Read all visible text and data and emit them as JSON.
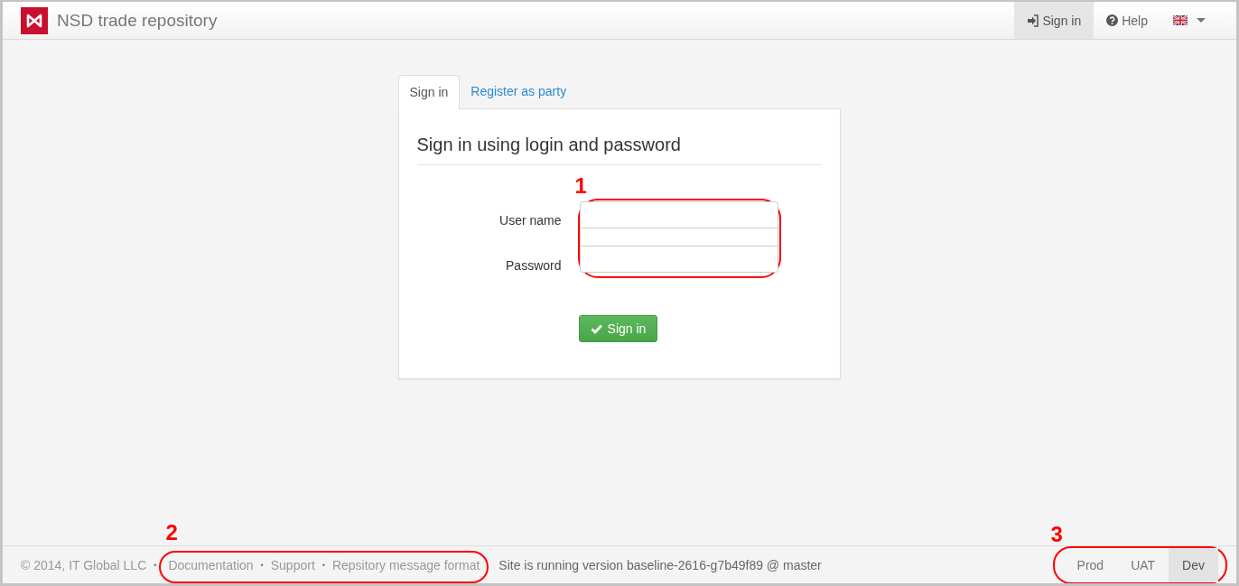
{
  "navbar": {
    "brand": "NSD trade repository",
    "items": [
      {
        "kind": "signin",
        "label": "Sign in",
        "selected": true
      },
      {
        "kind": "help",
        "label": "Help",
        "selected": false
      },
      {
        "kind": "language",
        "selected": false
      }
    ]
  },
  "tabs": [
    {
      "label": "Sign in",
      "selected": true
    },
    {
      "label": "Register as party",
      "selected": false
    }
  ],
  "form": {
    "title": "Sign in using login and password",
    "annotation": "1",
    "fields": [
      {
        "label": "User name"
      },
      {
        "label": "Password"
      }
    ],
    "submit": "Sign in"
  },
  "footer": {
    "copyright": "© 2014, IT Global LLC",
    "separator": "•",
    "annotation": "2",
    "links": [
      "Documentation",
      "Support",
      "Repsitory message format"
    ],
    "version": "Site is running version baseline-2616-g7b49f89 @ master",
    "environments": {
      "annotation": "3",
      "items": [
        {
          "label": "Prod",
          "selected": false
        },
        {
          "label": "UAT",
          "selected": false
        },
        {
          "label": "Dev",
          "selected": true
        }
      ]
    }
  }
}
